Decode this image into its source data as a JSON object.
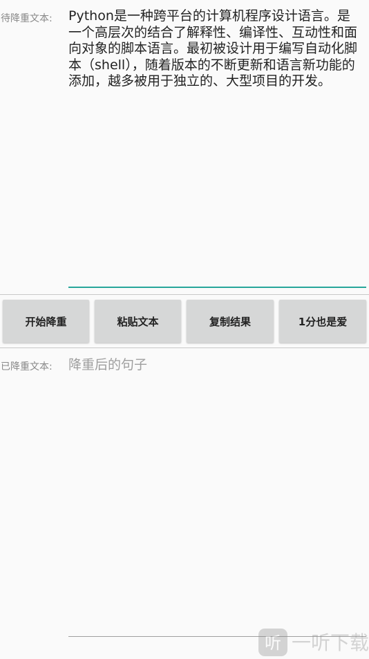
{
  "input_section": {
    "label": "待降重文本:",
    "text": "Python是一种跨平台的计算机程序设计语言。是一个高层次的结合了解释性、编译性、互动性和面向对象的脚本语言。最初被设计用于编写自动化脚本（shell），随着版本的不断更新和语言新功能的添加，越多被用于独立的、大型项目的开发。"
  },
  "buttons": {
    "start_label": "开始降重",
    "paste_label": "粘贴文本",
    "copy_label": "复制结果",
    "donate_label": "1分也是爱"
  },
  "output_section": {
    "label": "已降重文本:",
    "placeholder": "降重后的句子"
  },
  "watermark": {
    "logo_text": "听",
    "text": "一听下载"
  },
  "colors": {
    "accent": "#26a69a",
    "button_bg": "#d6d7d7",
    "label": "#888888",
    "hint": "#9e9e9e"
  }
}
